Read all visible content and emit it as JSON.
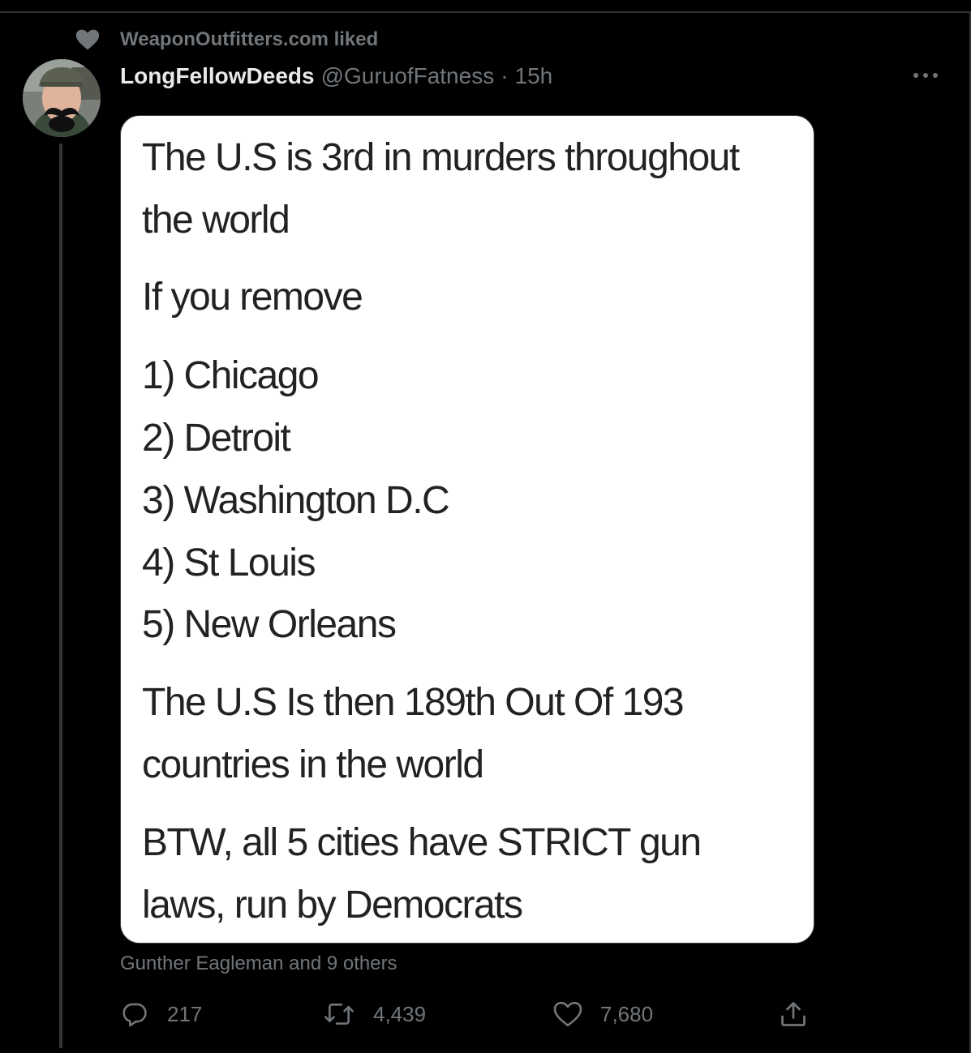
{
  "social_context": {
    "icon": "heart-icon",
    "text": "WeaponOutfitters.com liked"
  },
  "tweet": {
    "display_name": "LongFellowDeeds",
    "handle": "@GuruofFatness",
    "separator": "·",
    "time": "15h",
    "more_icon": "more-horizontal-icon",
    "media_text": {
      "line1": "The U.S is 3rd in murders throughout",
      "line2": "the world",
      "line3": "If you remove",
      "item1": "1) Chicago",
      "item2": "2) Detroit",
      "item3": "3) Washington D.C",
      "item4": "4) St Louis",
      "item5": "5) New Orleans",
      "line4": "The U.S Is then 189th Out Of 193",
      "line5": "countries in the world",
      "line6": "BTW, all 5 cities have STRICT gun",
      "line7": "laws, run by Democrats"
    },
    "tagged": "Gunther Eagleman and 9 others",
    "actions": {
      "reply": {
        "icon": "reply-icon",
        "count": "217"
      },
      "retweet": {
        "icon": "retweet-icon",
        "count": "4,439"
      },
      "like": {
        "icon": "like-icon",
        "count": "7,680"
      },
      "share": {
        "icon": "share-icon"
      }
    }
  },
  "colors": {
    "background": "#000000",
    "text_primary": "#e7e9ea",
    "text_secondary": "#71767b",
    "border": "#2f3336"
  }
}
